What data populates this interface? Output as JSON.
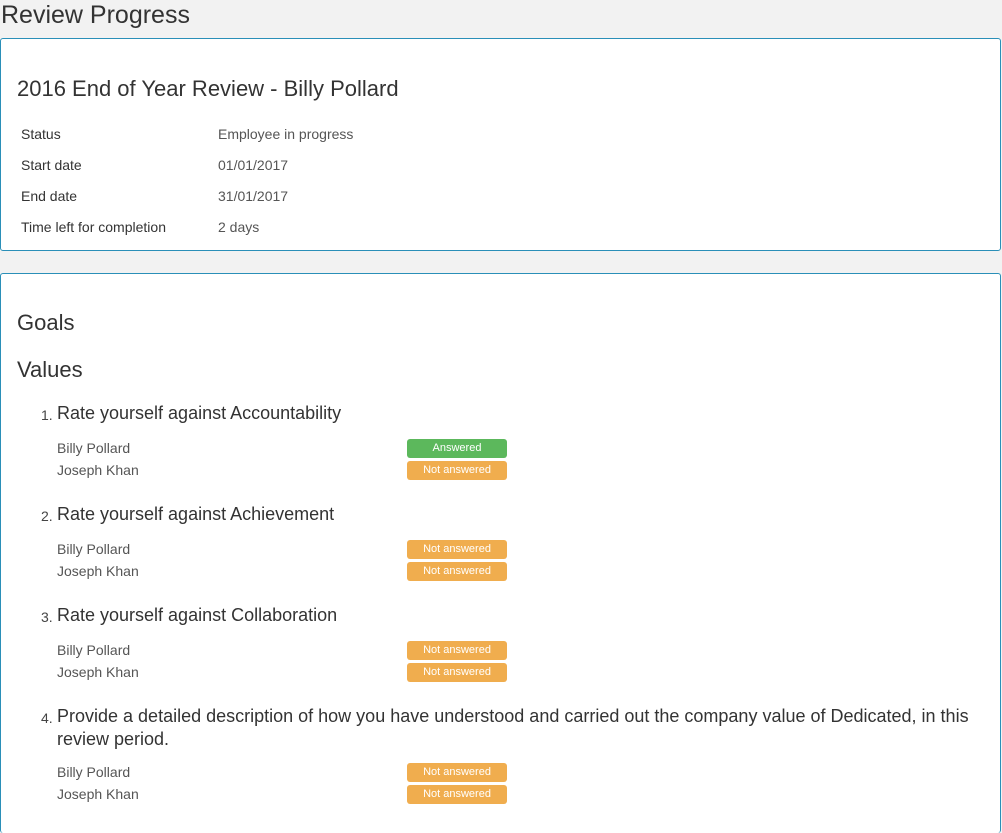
{
  "page": {
    "title": "Review Progress"
  },
  "summary": {
    "heading": "2016 End of Year Review - Billy Pollard",
    "rows": [
      {
        "label": "Status",
        "value": "Employee in progress"
      },
      {
        "label": "Start date",
        "value": "01/01/2017"
      },
      {
        "label": "End date",
        "value": "31/01/2017"
      },
      {
        "label": "Time left for completion",
        "value": "2 days"
      }
    ]
  },
  "sections": {
    "goals": "Goals",
    "values": "Values"
  },
  "questions": [
    {
      "num": "1.",
      "text": "Rate yourself against Accountability",
      "responses": [
        {
          "name": "Billy Pollard",
          "status": "Answered",
          "state": "answered"
        },
        {
          "name": "Joseph Khan",
          "status": "Not answered",
          "state": "not"
        }
      ]
    },
    {
      "num": "2.",
      "text": "Rate yourself against Achievement",
      "responses": [
        {
          "name": "Billy Pollard",
          "status": "Not answered",
          "state": "not"
        },
        {
          "name": "Joseph Khan",
          "status": "Not answered",
          "state": "not"
        }
      ]
    },
    {
      "num": "3.",
      "text": "Rate yourself against Collaboration",
      "responses": [
        {
          "name": "Billy Pollard",
          "status": "Not answered",
          "state": "not"
        },
        {
          "name": "Joseph Khan",
          "status": "Not answered",
          "state": "not"
        }
      ]
    },
    {
      "num": "4.",
      "text": "Provide a detailed description of how you have understood and carried out the company value of Dedicated, in this review period.",
      "responses": [
        {
          "name": "Billy Pollard",
          "status": "Not answered",
          "state": "not"
        },
        {
          "name": "Joseph Khan",
          "status": "Not answered",
          "state": "not"
        }
      ]
    }
  ],
  "colors": {
    "answered": "#5cb85c",
    "not_answered": "#f0ad4e",
    "card_border": "#2a8fb8"
  }
}
